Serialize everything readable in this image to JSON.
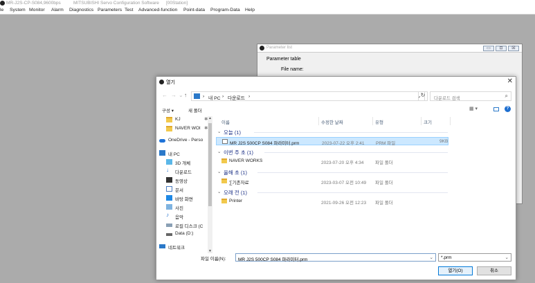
{
  "app": {
    "title": "MR-J2S-CP-S084,9600bps",
    "software": "MITSUBISHI Servo Configuration Software",
    "station": "[00Station]"
  },
  "menu": [
    "le",
    "System",
    "Monitor",
    "Alarm",
    "Diagnostics",
    "Parameters",
    "Test",
    "Advanced-function",
    "Point-data",
    "Program-Data",
    "Help"
  ],
  "param_window": {
    "title": "Parameter list",
    "table_label": "Parameter table",
    "file_name_label": "File name:",
    "btn_min": "▭",
    "btn_max": "⊡",
    "btn_close": "☒"
  },
  "dialog": {
    "title": "열기",
    "close": "✕",
    "nav": {
      "back": "←",
      "forward": "→",
      "dropdown": "⌄",
      "up": "↑"
    },
    "breadcrumb": [
      "내 PC",
      "›",
      "다운로드",
      "›"
    ],
    "breadcrumb_lead": "›",
    "search_placeholder": "다운로드 검색",
    "refresh": "↻",
    "organize": "구성 ▾",
    "new_folder": "새 폴더",
    "view_label": "▦ ▾",
    "help": "?",
    "columns": [
      "이름",
      "수정한 날짜",
      "유형",
      "크기"
    ],
    "nav_pane": [
      {
        "label": "KJ",
        "pin": "✱ ^",
        "icon": "folder-icon"
      },
      {
        "label": "NAVER WOI",
        "pin": "✱",
        "icon": "folder-icon"
      },
      {
        "label": "OneDrive - Perso",
        "icon": "cloud-icon"
      },
      {
        "label": "내 PC",
        "icon": "pc-icon"
      },
      {
        "label": "3D 개체",
        "icon": "cube-icon"
      },
      {
        "label": "다운로드",
        "icon": "download-icon"
      },
      {
        "label": "동영상",
        "icon": "video-icon"
      },
      {
        "label": "문서",
        "icon": "document-icon"
      },
      {
        "label": "바탕 화면",
        "icon": "desktop-icon"
      },
      {
        "label": "사진",
        "icon": "picture-icon"
      },
      {
        "label": "음악",
        "icon": "music-icon"
      },
      {
        "label": "로컬 디스크 (C",
        "icon": "disk-icon"
      },
      {
        "label": "Data (D:)",
        "icon": "drive-icon"
      },
      {
        "label": "네트워크",
        "icon": "network-icon"
      }
    ],
    "groups": [
      {
        "label": "오늘 (1)",
        "rows": [
          {
            "name": "MR J2S 500CP S084 파라미터.prm",
            "date": "2023-07-22 오후 2:41",
            "type": "PRM 파일",
            "size": "9KB",
            "selected": true,
            "icon": "file-icon"
          }
        ]
      },
      {
        "label": "이번 주 초 (1)",
        "rows": [
          {
            "name": "NAVER WORKS",
            "date": "2023-07-20 오후 4:34",
            "type": "파일 폴더",
            "size": "",
            "selected": false,
            "icon": "folder-icon"
          }
        ]
      },
      {
        "label": "올해 초 (1)",
        "rows": [
          {
            "name": "∑기존자료",
            "date": "2023-03-07 오전 10:49",
            "type": "파일 폴더",
            "size": "",
            "selected": false,
            "icon": "folder-icon"
          }
        ]
      },
      {
        "label": "오래 전 (1)",
        "rows": [
          {
            "name": "Printer",
            "date": "2021-09-26 오전 12:23",
            "type": "파일 폴더",
            "size": "",
            "selected": false,
            "icon": "folder-icon"
          }
        ]
      }
    ],
    "file_name_label": "파일 이름(N):",
    "file_name_value": "MR J2S 500CP S084 파라미터.prm",
    "file_type_value": "*.prm",
    "open_button": "열기(O)",
    "cancel_button": "취소"
  }
}
